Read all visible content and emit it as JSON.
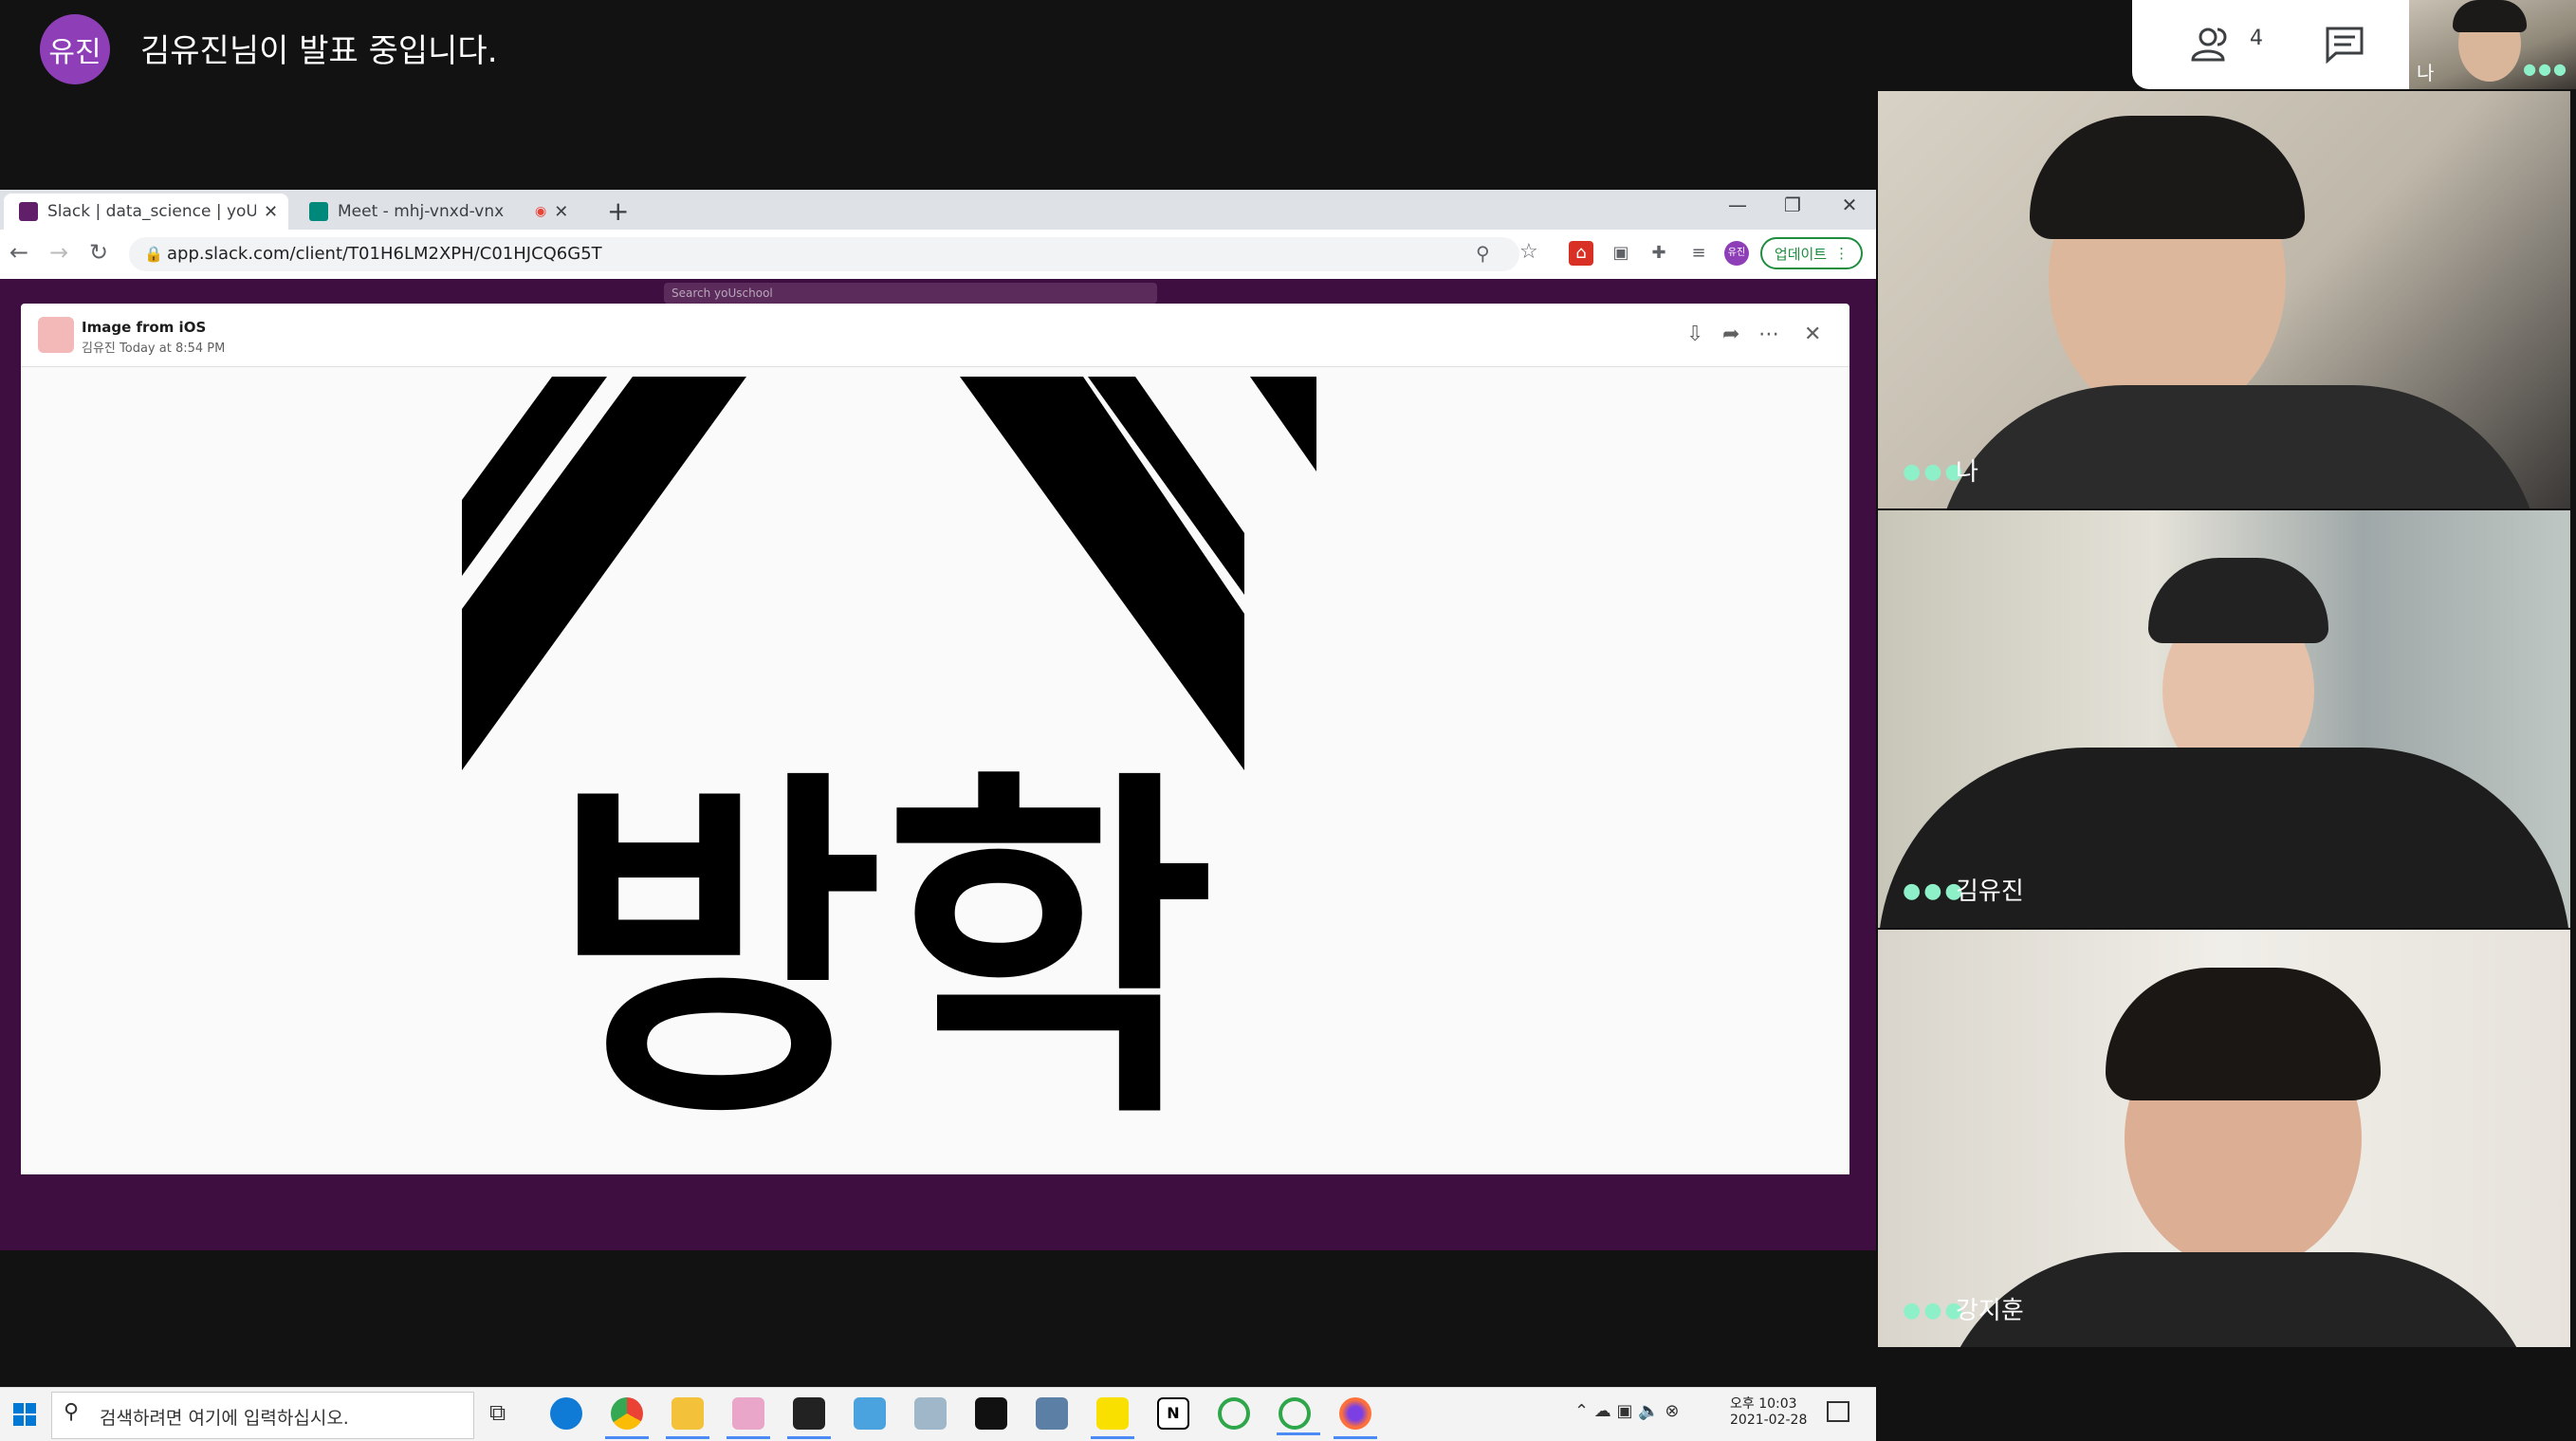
{
  "meet": {
    "presenter_initials": "유진",
    "presenter_banner": "김유진님이 발표 중입니다.",
    "participants_count": "4",
    "self_thumb_label": "나",
    "tiles": [
      {
        "name": "나"
      },
      {
        "name": "김유진"
      },
      {
        "name": "강지훈"
      }
    ]
  },
  "browser": {
    "tabs": [
      {
        "label": "Slack | data_science | yoUschool"
      },
      {
        "label": "Meet - mhj-vnxd-vnx"
      }
    ],
    "url": "app.slack.com/client/T01H6LM2XPH/C01HJCQ6G5T",
    "update_label": "업데이트",
    "profile_initials": "유진"
  },
  "slack": {
    "search_placeholder": "Search yoUschool",
    "modal": {
      "title": "Image from iOS",
      "subtitle": "김유진 Today at 8:54 PM",
      "image_text": "방학"
    }
  },
  "taskbar": {
    "search_placeholder": "검색하려면 여기에 입력하십시오.",
    "time": "오후 10:03",
    "date": "2021-02-28"
  },
  "colors": {
    "presenter_avatar": "#8e3fb8",
    "slack_aubergine": "#3f0e40",
    "update_green": "#1e8e3e",
    "speaking_dots": "#8ef0c8"
  }
}
